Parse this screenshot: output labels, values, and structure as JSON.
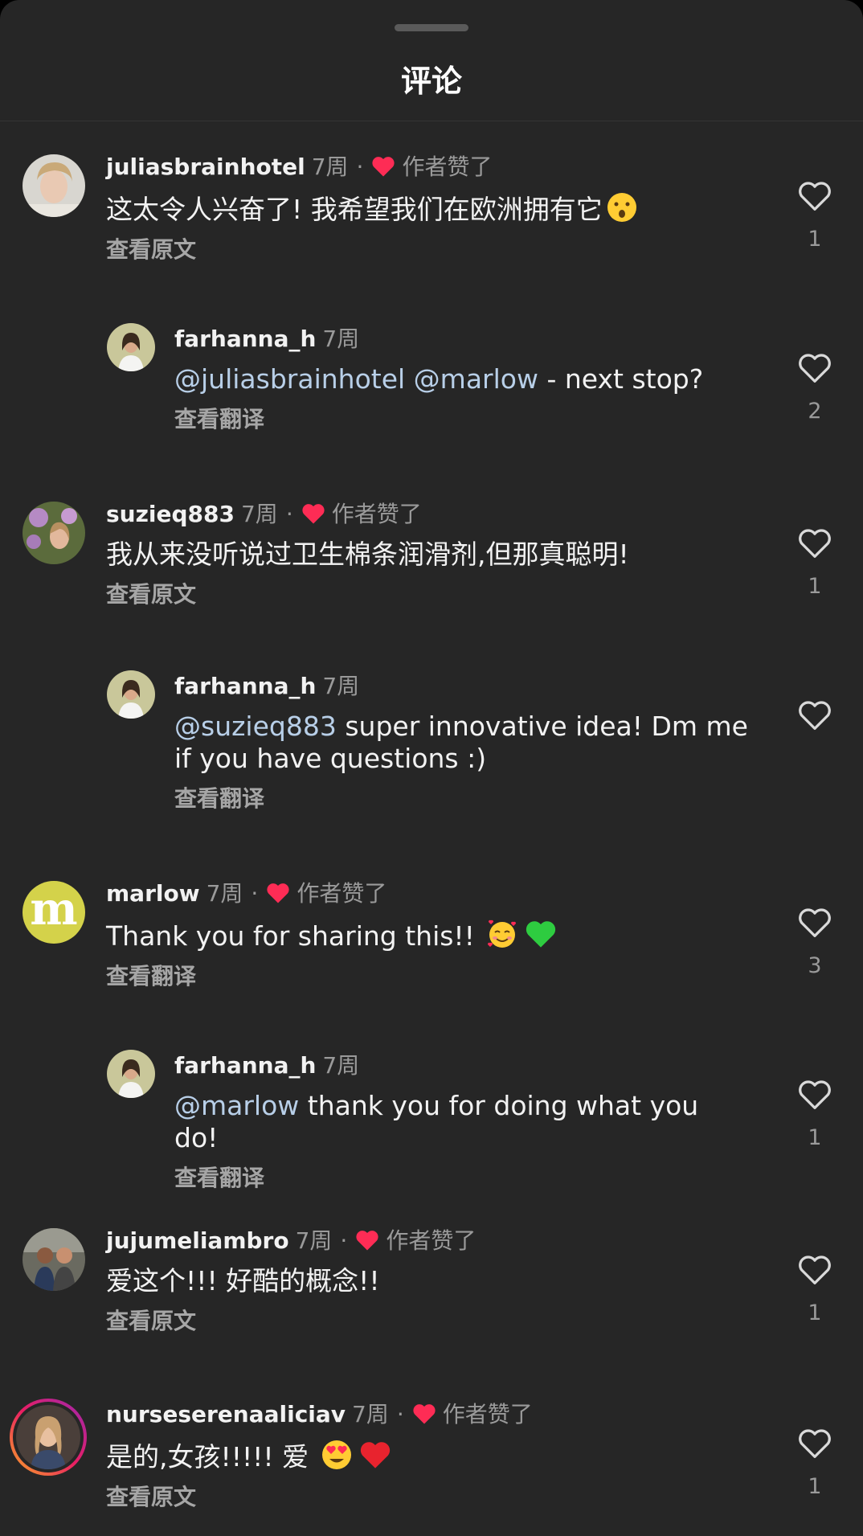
{
  "header": {
    "title": "评论"
  },
  "comments": [
    {
      "username": "juliasbrainhotel",
      "time": "7周",
      "dot": "·",
      "liked_label": "作者赞了",
      "text": "这太令人兴奋了! 我希望我们在欧洲拥有它",
      "emojis": [
        "hushed-face"
      ],
      "translate": "查看原文",
      "likes": "1"
    },
    {
      "username": "farhanna_h",
      "time": "7周",
      "mention1": "@juliasbrainhotel",
      "mention2": "@marlow",
      "text": " - next stop?",
      "translate": "查看翻译",
      "likes": "2"
    },
    {
      "username": "suzieq883",
      "time": "7周",
      "dot": "·",
      "liked_label": "作者赞了",
      "text": "我从来没听说过卫生棉条润滑剂,但那真聪明!",
      "translate": "查看原文",
      "likes": "1"
    },
    {
      "username": "farhanna_h",
      "time": "7周",
      "mention1": "@suzieq883",
      "text": " super innovative idea! Dm me if you have questions :)",
      "translate": "查看翻译",
      "likes": ""
    },
    {
      "username": "marlow",
      "avatar_letter": "m",
      "time": "7周",
      "dot": "·",
      "liked_label": "作者赞了",
      "text": "Thank you for sharing this!!",
      "emojis": [
        "smiling-face-with-hearts",
        "green-heart"
      ],
      "translate": "查看翻译",
      "likes": "3"
    },
    {
      "username": "farhanna_h",
      "time": "7周",
      "mention1": "@marlow",
      "text": " thank you for doing what you do!",
      "translate": "查看翻译",
      "likes": "1"
    },
    {
      "username": "jujumeliambro",
      "time": "7周",
      "dot": "·",
      "liked_label": "作者赞了",
      "text": "爱这个!!! 好酷的概念!!",
      "translate": "查看原文",
      "likes": "1"
    },
    {
      "username": "nurseserenaaliciav",
      "time": "7周",
      "dot": "·",
      "liked_label": "作者赞了",
      "text": "是的,女孩!!!!! 爱",
      "emojis": [
        "heart-eyes",
        "red-heart"
      ],
      "translate": "查看原文",
      "likes": "1"
    }
  ],
  "colors": {
    "background": "#262626",
    "heart_red": "#fe2c55",
    "mention": "#b8cfe8",
    "marlow_avatar": "#d4d24a"
  }
}
